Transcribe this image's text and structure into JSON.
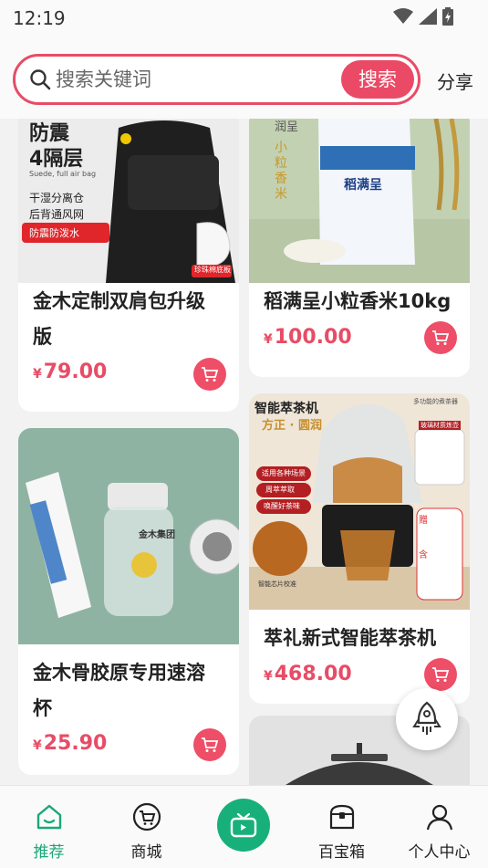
{
  "status_bar": {
    "time": "12:19"
  },
  "search": {
    "placeholder": "搜索关键词",
    "button_label": "搜索",
    "share_label": "分享"
  },
  "products": [
    {
      "title_lines": [
        "金木定制双肩包升级",
        "版"
      ],
      "currency": "¥",
      "price": "79.00",
      "image_texts": [
        "防震",
        "4隔层",
        "Suede, full air bag",
        "干湿分离仓",
        "后背通风网",
        "防震防泼水",
        "珍珠棉底板"
      ]
    },
    {
      "title_lines": [
        "稻满呈小粒香米10kg"
      ],
      "currency": "¥",
      "price": "100.00",
      "image_texts": [
        "润呈",
        "小粒香米",
        "稻满呈"
      ]
    },
    {
      "title_lines": [
        "金木骨胶原专用速溶",
        "杯"
      ],
      "currency": "¥",
      "price": "25.90",
      "image_texts": [
        "金木集团"
      ]
    },
    {
      "title_lines": [
        "萃礼新式智能萃茶机"
      ],
      "currency": "¥",
      "price": "468.00",
      "image_texts": [
        "智能萃茶机",
        "方正 · 圆润",
        "适用各种场景",
        "周萃萃取",
        "唤醒好茶味",
        "智能芯片校准",
        "多功能的煮茶器",
        "玻璃材质炼壶",
        "赠",
        "含"
      ]
    }
  ],
  "tabs": [
    {
      "label": "推荐",
      "icon": "home-smile-icon",
      "active": true
    },
    {
      "label": "商城",
      "icon": "cart-icon",
      "active": false
    },
    {
      "label": "",
      "icon": "tv-icon",
      "active": false
    },
    {
      "label": "百宝箱",
      "icon": "treasure-box-icon",
      "active": false
    },
    {
      "label": "个人中心",
      "icon": "person-icon",
      "active": false
    }
  ],
  "colors": {
    "accent": "#e84c66",
    "tab_active": "#1aa876"
  }
}
